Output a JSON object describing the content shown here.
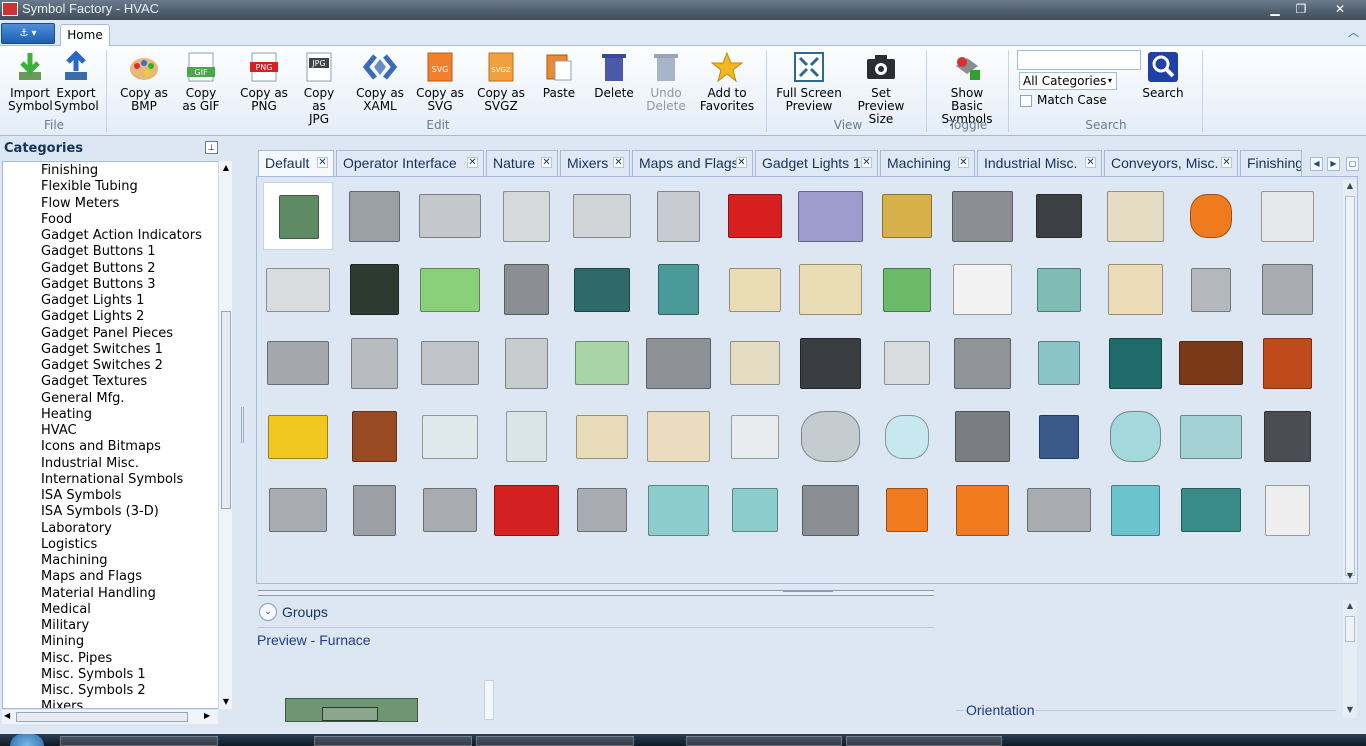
{
  "window": {
    "title": "Symbol Factory - HVAC",
    "minimize": "▁",
    "maximize": "❐",
    "close": "✕"
  },
  "ribbon": {
    "app_menu_icon": "app-menu-icon",
    "tabs": [
      "Home"
    ],
    "collapse_glyph": "︿",
    "buttons": [
      {
        "id": "import",
        "line1": "Import",
        "line2": "Symbol",
        "enabled": true
      },
      {
        "id": "export",
        "line1": "Export",
        "line2": "Symbol",
        "enabled": true
      },
      {
        "id": "copy-bmp",
        "line1": "Copy as",
        "line2": "BMP",
        "enabled": true
      },
      {
        "id": "copy-gif",
        "line1": "Copy",
        "line2": "as GIF",
        "enabled": true
      },
      {
        "id": "copy-png",
        "line1": "Copy as",
        "line2": "PNG",
        "enabled": true
      },
      {
        "id": "copy-jpg",
        "line1": "Copy as",
        "line2": "JPG",
        "enabled": true
      },
      {
        "id": "copy-xaml",
        "line1": "Copy as",
        "line2": "XAML",
        "enabled": true
      },
      {
        "id": "copy-svg",
        "line1": "Copy as",
        "line2": "SVG",
        "enabled": true
      },
      {
        "id": "copy-svgz",
        "line1": "Copy as",
        "line2": "SVGZ",
        "enabled": true
      },
      {
        "id": "paste",
        "line1": "Paste",
        "line2": "",
        "enabled": true
      },
      {
        "id": "delete",
        "line1": "Delete",
        "line2": "",
        "enabled": true
      },
      {
        "id": "undo-delete",
        "line1": "Undo",
        "line2": "Delete",
        "enabled": false
      },
      {
        "id": "add-favorites",
        "line1": "Add to",
        "line2": "Favorites",
        "enabled": true
      },
      {
        "id": "full-screen",
        "line1": "Full Screen",
        "line2": "Preview",
        "enabled": true
      },
      {
        "id": "set-preview",
        "line1": "Set",
        "line2": "Preview Size",
        "enabled": true
      },
      {
        "id": "show-basic",
        "line1": "Show Basic",
        "line2": "Symbols",
        "enabled": true
      },
      {
        "id": "search",
        "line1": "Search",
        "line2": "",
        "enabled": true
      }
    ],
    "groups": [
      "File",
      "Edit",
      "View",
      "Toggle",
      "Search"
    ],
    "icon_labels": {
      "gif": "GIF",
      "png": "PNG",
      "jpg": "JPG",
      "svg": "SVG",
      "svgz": "SVGZ"
    },
    "search": {
      "value": "",
      "category_selected": "All Categories",
      "category_arrow": "▾",
      "match_case_label": "Match Case",
      "match_case_checked": false
    }
  },
  "categories": {
    "header": "Categories",
    "pin_glyph": "⊥",
    "items": [
      "Finishing",
      "Flexible Tubing",
      "Flow Meters",
      "Food",
      "Gadget Action Indicators",
      "Gadget Buttons 1",
      "Gadget Buttons 2",
      "Gadget Buttons 3",
      "Gadget Lights 1",
      "Gadget Lights 2",
      "Gadget Panel Pieces",
      "Gadget Switches 1",
      "Gadget Switches 2",
      "Gadget Textures",
      "General Mfg.",
      "Heating",
      "HVAC",
      "Icons and Bitmaps",
      "Industrial Misc.",
      "International Symbols",
      "ISA Symbols",
      "ISA Symbols (3-D)",
      "Laboratory",
      "Logistics",
      "Machining",
      "Maps and Flags",
      "Material Handling",
      "Medical",
      "Military",
      "Mining",
      "Misc. Pipes",
      "Misc. Symbols 1",
      "Misc. Symbols 2",
      "Mixers"
    ],
    "selected": "HVAC",
    "scroll_up": "▲",
    "scroll_down": "▼",
    "scroll_left": "◀",
    "scroll_right": "▶"
  },
  "doc_tabs": {
    "tabs": [
      "Default",
      "Operator Interface",
      "Nature",
      "Mixers",
      "Maps and Flags",
      "Gadget Lights 1",
      "Machining",
      "Industrial Misc.",
      "Conveyors, Misc.",
      "Finishing"
    ],
    "close_glyph": "✕",
    "prev": "◀",
    "next": "▶",
    "menu": "▢"
  },
  "gallery": {
    "selected_index": 0,
    "scroll_up": "▲",
    "scroll_down": "▼",
    "symbols": [
      {
        "name": "furnace",
        "color": "#5e8a64"
      },
      {
        "name": "rooftop-unit",
        "color": "#9aa0a6"
      },
      {
        "name": "duct-hood",
        "color": "#c4c8cc"
      },
      {
        "name": "duct-section",
        "color": "#d6d9dc"
      },
      {
        "name": "duct-transition",
        "color": "#d2d5d8"
      },
      {
        "name": "air-handler-tall",
        "color": "#c8ccd0"
      },
      {
        "name": "red-cabinet",
        "color": "#d81f1f"
      },
      {
        "name": "purple-unit",
        "color": "#9c9ccf"
      },
      {
        "name": "gold-duct",
        "color": "#d8b04a"
      },
      {
        "name": "machine-gray",
        "color": "#8a8e92"
      },
      {
        "name": "control-panel-dark",
        "color": "#3c4044"
      },
      {
        "name": "beige-cabinet",
        "color": "#e6dcc4"
      },
      {
        "name": "orange-tank",
        "color": "#f07b1e"
      },
      {
        "name": "thermostat-tower",
        "color": "#e6e8ea"
      },
      {
        "name": "window-ac",
        "color": "#d8dcdf"
      },
      {
        "name": "dark-grille-box",
        "color": "#2c3a30"
      },
      {
        "name": "green-unit",
        "color": "#8ad07a"
      },
      {
        "name": "vent-strip",
        "color": "#8a8e92"
      },
      {
        "name": "teal-chiller",
        "color": "#2f6a6a"
      },
      {
        "name": "teal-pump",
        "color": "#4a9a9a"
      },
      {
        "name": "beige-tall",
        "color": "#eadcb4"
      },
      {
        "name": "beige-wide",
        "color": "#eadcb4"
      },
      {
        "name": "green-compressor",
        "color": "#6aba6a"
      },
      {
        "name": "white-cabinet",
        "color": "#f2f2f2"
      },
      {
        "name": "teal-cabinet",
        "color": "#7fbcb4"
      },
      {
        "name": "beige-display",
        "color": "#ecdcb8"
      },
      {
        "name": "exhaust-fan",
        "color": "#b4b8bc"
      },
      {
        "name": "roof-fan",
        "color": "#a8acb0"
      },
      {
        "name": "roof-vent-dome",
        "color": "#a4a8ac"
      },
      {
        "name": "ceiling-diffuser",
        "color": "#b8bcc0"
      },
      {
        "name": "roof-stack",
        "color": "#c0c4c8"
      },
      {
        "name": "duct-elbow",
        "color": "#c8cccf"
      },
      {
        "name": "green-panel",
        "color": "#a8d4a8"
      },
      {
        "name": "heat-exchanger",
        "color": "#8e9296"
      },
      {
        "name": "long-grille",
        "color": "#e6dcc4"
      },
      {
        "name": "dark-grille",
        "color": "#3a3e42"
      },
      {
        "name": "flat-diffuser",
        "color": "#d8dcdf"
      },
      {
        "name": "valve-pipe",
        "color": "#909498"
      },
      {
        "name": "teal-strip",
        "color": "#8ac4c8"
      },
      {
        "name": "teal-grille",
        "color": "#1f6a6a"
      },
      {
        "name": "brown-coil",
        "color": "#7a3a1a"
      },
      {
        "name": "orange-coil",
        "color": "#c04a1a"
      },
      {
        "name": "yellow-filter",
        "color": "#f0c820"
      },
      {
        "name": "copper-coil",
        "color": "#9a4a22"
      },
      {
        "name": "glass-panel",
        "color": "#dfe8ea"
      },
      {
        "name": "glass-panel-2",
        "color": "#d8e6e8"
      },
      {
        "name": "beige-louver",
        "color": "#e8dcb8"
      },
      {
        "name": "beige-louver-2",
        "color": "#eadcc0"
      },
      {
        "name": "dark-louver",
        "color": "#e8ecee"
      },
      {
        "name": "round-damper",
        "color": "#c4ccd0"
      },
      {
        "name": "round-diffuser",
        "color": "#c6e8ee"
      },
      {
        "name": "inline-fan",
        "color": "#7a7e82"
      },
      {
        "name": "blower-motor",
        "color": "#3a5a8a"
      },
      {
        "name": "teal-tank",
        "color": "#a4d8dc"
      },
      {
        "name": "teal-pipe-fitting",
        "color": "#a4d0d4"
      },
      {
        "name": "dark-column",
        "color": "#4a4e52"
      },
      {
        "name": "water-heater-small",
        "color": "#a8acb0"
      },
      {
        "name": "water-heater-tall",
        "color": "#9ca0a4"
      },
      {
        "name": "boiler-cylinder",
        "color": "#a8acb0"
      },
      {
        "name": "red-hopper",
        "color": "#d42020"
      },
      {
        "name": "gray-hopper",
        "color": "#a8acb0"
      },
      {
        "name": "teal-hood",
        "color": "#8ccccc"
      },
      {
        "name": "teal-hood-workers",
        "color": "#8ccccc"
      },
      {
        "name": "gray-cabinet",
        "color": "#8a8e92"
      },
      {
        "name": "orange-valve",
        "color": "#f07b1e"
      },
      {
        "name": "orange-pump",
        "color": "#f07b1e"
      },
      {
        "name": "gray-chiller",
        "color": "#a8acb0"
      },
      {
        "name": "teal-manifold",
        "color": "#6ac4cc"
      },
      {
        "name": "teal-vessel",
        "color": "#3a8a8a"
      },
      {
        "name": "white-tower",
        "color": "#eeeeee"
      },
      {
        "name": "red-unit",
        "color": "#b42020"
      },
      {
        "name": "teal-pipe",
        "color": "#8cccd0"
      },
      {
        "name": "grille-small",
        "color": "#c4c8cc"
      },
      {
        "name": "grid-icon",
        "color": "#2a2e32"
      },
      {
        "name": "plate",
        "color": "#c8cccf"
      }
    ]
  },
  "groups": {
    "label": "Groups",
    "expand_glyph": "⌄"
  },
  "preview": {
    "label": "Preview - Furnace",
    "orientation_label": "Orientation",
    "scroll_up": "▲",
    "scroll_down": "▼"
  }
}
